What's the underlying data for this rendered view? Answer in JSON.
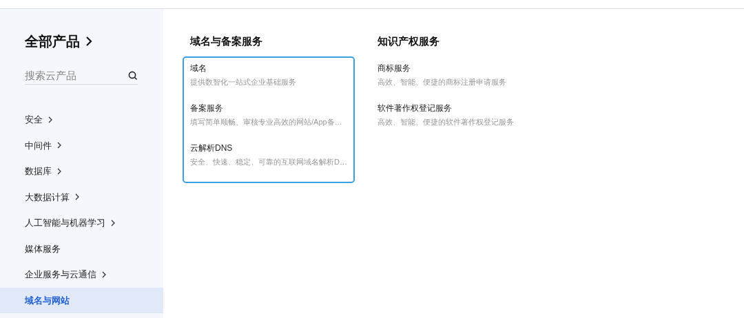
{
  "sidebar": {
    "title": "全部产品",
    "search": {
      "placeholder": "搜索云产品"
    },
    "items": [
      {
        "label": "安全",
        "has_submenu": true,
        "selected": false
      },
      {
        "label": "中间件",
        "has_submenu": true,
        "selected": false
      },
      {
        "label": "数据库",
        "has_submenu": true,
        "selected": false
      },
      {
        "label": "大数据计算",
        "has_submenu": true,
        "selected": false
      },
      {
        "label": "人工智能与机器学习",
        "has_submenu": true,
        "selected": false
      },
      {
        "label": "媒体服务",
        "has_submenu": false,
        "selected": false
      },
      {
        "label": "企业服务与云通信",
        "has_submenu": true,
        "selected": false
      },
      {
        "label": "域名与网站",
        "has_submenu": false,
        "selected": true
      }
    ]
  },
  "groups": [
    {
      "title": "域名与备案服务",
      "selected": true,
      "items": [
        {
          "name": "域名",
          "description": "提供数智化一站式企业基础服务"
        },
        {
          "name": "备案服务",
          "description": "填写简单顺畅、审核专业高效的网站/App备…"
        },
        {
          "name": "云解析DNS",
          "description": "安全、快速、稳定、可靠的互联网域名解析D…"
        }
      ]
    },
    {
      "title": "知识产权服务",
      "selected": false,
      "items": [
        {
          "name": "商标服务",
          "description": "高效、智能、便捷的商标注册申请服务"
        },
        {
          "name": "软件著作权登记服务",
          "description": "高效、智能、便捷的软件著作权登记服务"
        }
      ]
    }
  ]
}
